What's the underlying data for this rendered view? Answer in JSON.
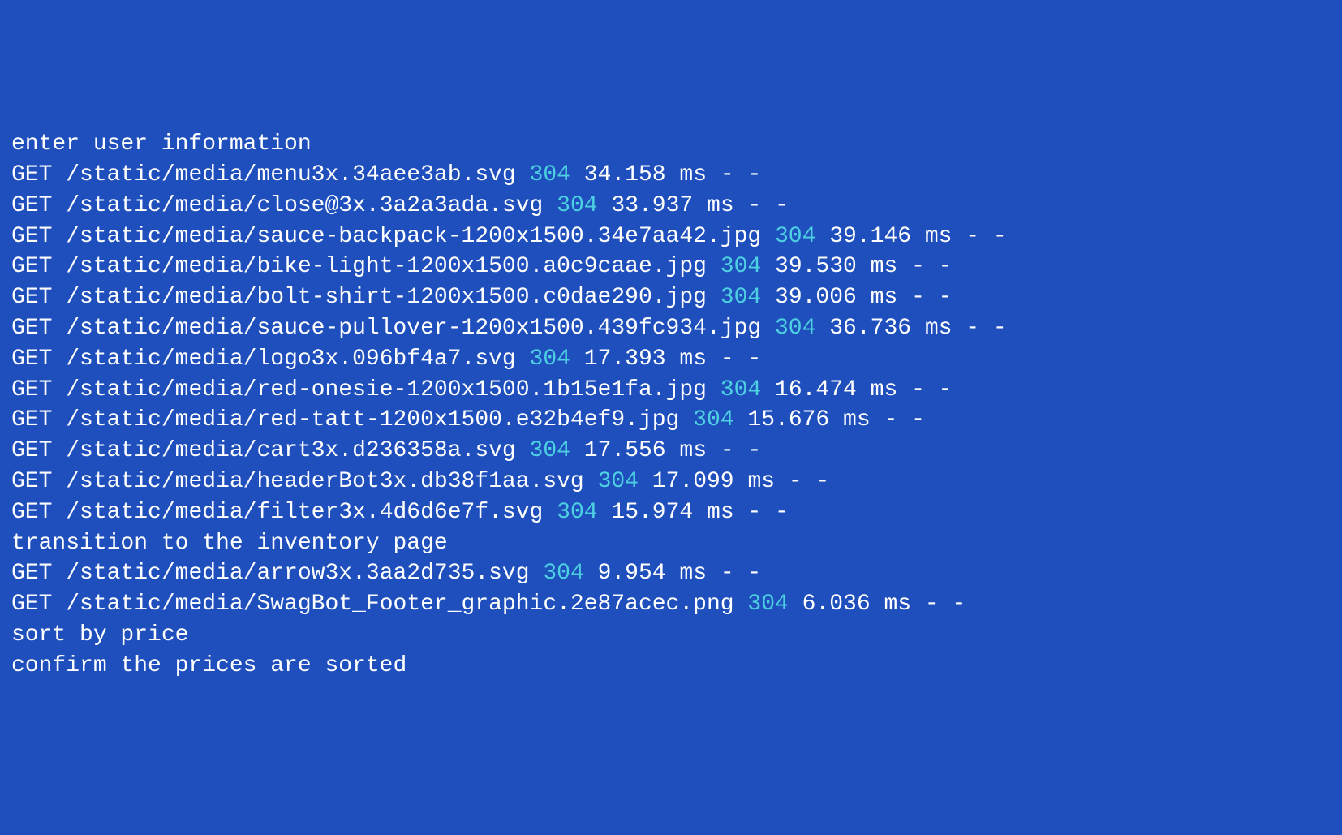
{
  "lines": [
    {
      "type": "message",
      "text": "enter user information"
    },
    {
      "type": "request",
      "method": "GET",
      "path": "/static/media/menu3x.34aee3ab.svg",
      "status": "304",
      "time": "34.158",
      "unit": "ms",
      "suffix": "- -"
    },
    {
      "type": "request",
      "method": "GET",
      "path": "/static/media/close@3x.3a2a3ada.svg",
      "status": "304",
      "time": "33.937",
      "unit": "ms",
      "suffix": "- -"
    },
    {
      "type": "request",
      "method": "GET",
      "path": "/static/media/sauce-backpack-1200x1500.34e7aa42.jpg",
      "status": "304",
      "time": "39.146",
      "unit": "ms",
      "suffix": "- -"
    },
    {
      "type": "request",
      "method": "GET",
      "path": "/static/media/bike-light-1200x1500.a0c9caae.jpg",
      "status": "304",
      "time": "39.530",
      "unit": "ms",
      "suffix": "- -"
    },
    {
      "type": "request",
      "method": "GET",
      "path": "/static/media/bolt-shirt-1200x1500.c0dae290.jpg",
      "status": "304",
      "time": "39.006",
      "unit": "ms",
      "suffix": "- -"
    },
    {
      "type": "request",
      "method": "GET",
      "path": "/static/media/sauce-pullover-1200x1500.439fc934.jpg",
      "status": "304",
      "time": "36.736",
      "unit": "ms",
      "suffix": "- -"
    },
    {
      "type": "request",
      "method": "GET",
      "path": "/static/media/logo3x.096bf4a7.svg",
      "status": "304",
      "time": "17.393",
      "unit": "ms",
      "suffix": "- -"
    },
    {
      "type": "request",
      "method": "GET",
      "path": "/static/media/red-onesie-1200x1500.1b15e1fa.jpg",
      "status": "304",
      "time": "16.474",
      "unit": "ms",
      "suffix": "- -"
    },
    {
      "type": "request",
      "method": "GET",
      "path": "/static/media/red-tatt-1200x1500.e32b4ef9.jpg",
      "status": "304",
      "time": "15.676",
      "unit": "ms",
      "suffix": "- -"
    },
    {
      "type": "request",
      "method": "GET",
      "path": "/static/media/cart3x.d236358a.svg",
      "status": "304",
      "time": "17.556",
      "unit": "ms",
      "suffix": "- -"
    },
    {
      "type": "request",
      "method": "GET",
      "path": "/static/media/headerBot3x.db38f1aa.svg",
      "status": "304",
      "time": "17.099",
      "unit": "ms",
      "suffix": "- -"
    },
    {
      "type": "request",
      "method": "GET",
      "path": "/static/media/filter3x.4d6d6e7f.svg",
      "status": "304",
      "time": "15.974",
      "unit": "ms",
      "suffix": "- -"
    },
    {
      "type": "message",
      "text": "transition to the inventory page"
    },
    {
      "type": "request",
      "method": "GET",
      "path": "/static/media/arrow3x.3aa2d735.svg",
      "status": "304",
      "time": "9.954",
      "unit": "ms",
      "suffix": "- -"
    },
    {
      "type": "request",
      "method": "GET",
      "path": "/static/media/SwagBot_Footer_graphic.2e87acec.png",
      "status": "304",
      "time": "6.036",
      "unit": "ms",
      "suffix": "- -"
    },
    {
      "type": "message",
      "text": "sort by price"
    },
    {
      "type": "message",
      "text": "confirm the prices are sorted"
    }
  ]
}
